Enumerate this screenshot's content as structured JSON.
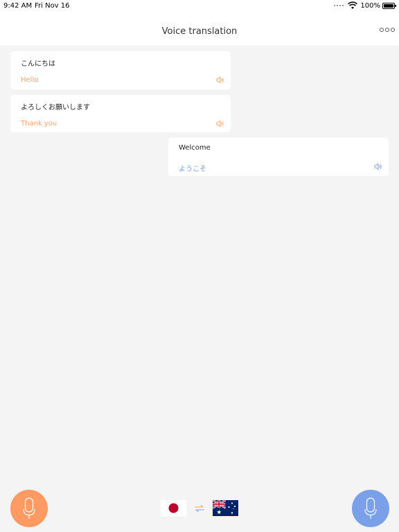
{
  "status_bar": {
    "time": "9:42 AM",
    "date": "Fri Nov 16",
    "battery": "100%"
  },
  "header": {
    "title": "Voice translation",
    "more_icon": "more-icon"
  },
  "conversation": [
    {
      "source": "こんにちは",
      "translation": "Hello",
      "side": "left",
      "color": "#f5a26c"
    },
    {
      "source": "よろしくお願いします",
      "translation": "Thank you",
      "side": "left",
      "color": "#f5a26c"
    },
    {
      "source": "Welcome",
      "translation": "ようこそ",
      "side": "right",
      "color": "#7a9ee8"
    }
  ],
  "controls": {
    "left_mic_color": "#ff9a63",
    "right_mic_color": "#7aa0ea",
    "source_language_flag": "japan-flag-icon",
    "target_language_flag": "australia-flag-icon",
    "swap_icon": "swap-icon",
    "mic_icon": "microphone-icon"
  }
}
